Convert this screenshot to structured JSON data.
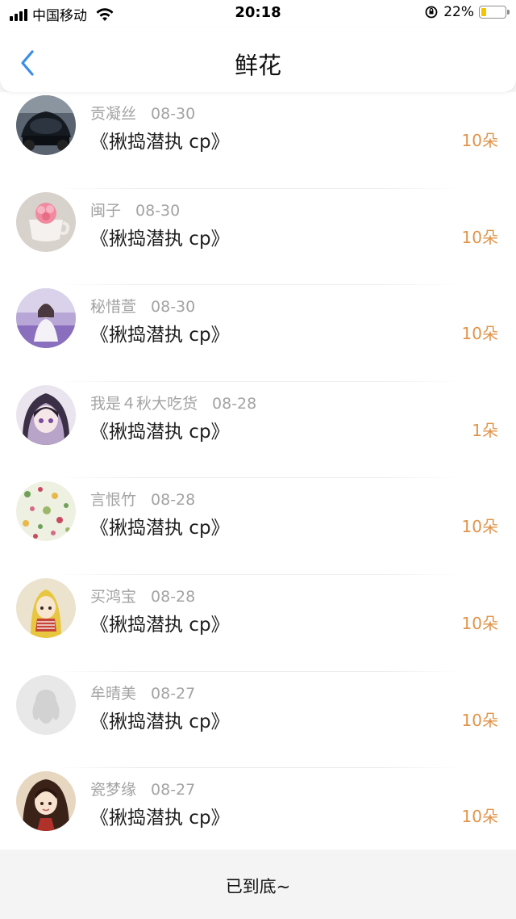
{
  "status": {
    "carrier": "中国移动",
    "time": "20:18",
    "battery": "22%",
    "battery_level": 0.22
  },
  "nav": {
    "title": "鲜花",
    "back_icon": "chevron-left-icon",
    "accent": "#3a8ee6"
  },
  "list": [
    {
      "name": "贡凝丝",
      "date": "08-30",
      "title": "《揪捣潜执 cp》",
      "count": "10朵",
      "avatar": "car"
    },
    {
      "name": "闽子",
      "date": "08-30",
      "title": "《揪捣潜执 cp》",
      "count": "10朵",
      "avatar": "teacup"
    },
    {
      "name": "秘惜萱",
      "date": "08-30",
      "title": "《揪捣潜执 cp》",
      "count": "10朵",
      "avatar": "lavender-girl"
    },
    {
      "name": "我是４秋大吃货",
      "date": "08-28",
      "title": "《揪捣潜执 cp》",
      "count": "1朵",
      "avatar": "anime-hood"
    },
    {
      "name": "言恨竹",
      "date": "08-28",
      "title": "《揪捣潜执 cp》",
      "count": "10朵",
      "avatar": "floral"
    },
    {
      "name": "买鸿宝",
      "date": "08-28",
      "title": "《揪捣潜执 cp》",
      "count": "10朵",
      "avatar": "blonde-anime"
    },
    {
      "name": "牟晴美",
      "date": "08-27",
      "title": "《揪捣潜执 cp》",
      "count": "10朵",
      "avatar": "default-penguin"
    },
    {
      "name": "瓷梦缘",
      "date": "08-27",
      "title": "《揪捣潜执 cp》",
      "count": "10朵",
      "avatar": "anime-girl"
    }
  ],
  "footer": {
    "text": "已到底~"
  },
  "colors": {
    "count": "#e0944a",
    "name": "#a3a3a3",
    "title": "#1e1e1e"
  }
}
